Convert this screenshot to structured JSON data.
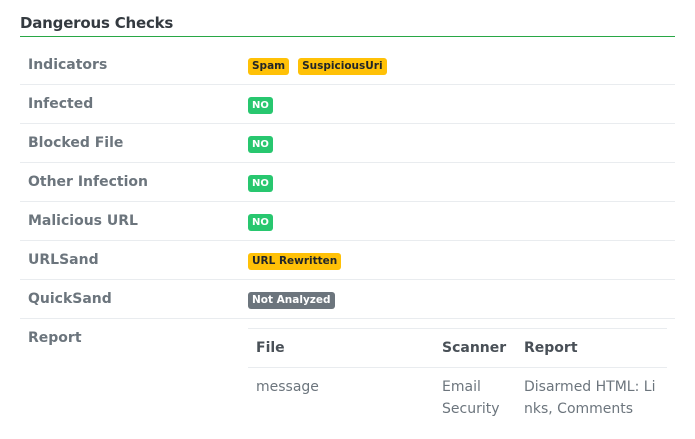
{
  "section": {
    "title": "Dangerous Checks"
  },
  "rows": [
    {
      "label": "Indicators",
      "badges": [
        {
          "text": "Spam",
          "variant": "warning"
        },
        {
          "text": "SuspiciousUri",
          "variant": "warning"
        }
      ]
    },
    {
      "label": "Infected",
      "badges": [
        {
          "text": "NO",
          "variant": "success"
        }
      ]
    },
    {
      "label": "Blocked File",
      "badges": [
        {
          "text": "NO",
          "variant": "success"
        }
      ]
    },
    {
      "label": "Other Infection",
      "badges": [
        {
          "text": "NO",
          "variant": "success"
        }
      ]
    },
    {
      "label": "Malicious URL",
      "badges": [
        {
          "text": "NO",
          "variant": "success"
        }
      ]
    },
    {
      "label": "URLSand",
      "badges": [
        {
          "text": "URL Rewritten",
          "variant": "warning"
        }
      ]
    },
    {
      "label": "QuickSand",
      "badges": [
        {
          "text": "Not Analyzed",
          "variant": "secondary"
        }
      ]
    }
  ],
  "report": {
    "label": "Report",
    "headers": {
      "file": "File",
      "scanner": "Scanner",
      "report": "Report"
    },
    "entries": [
      {
        "file": "message",
        "scanner": "Email Security",
        "report": "Disarmed HTML: Links, Comments"
      }
    ]
  },
  "colors": {
    "accent_rule": "#28a745",
    "warning": "#ffc107",
    "success": "#28c76f",
    "secondary": "#6c757d"
  }
}
